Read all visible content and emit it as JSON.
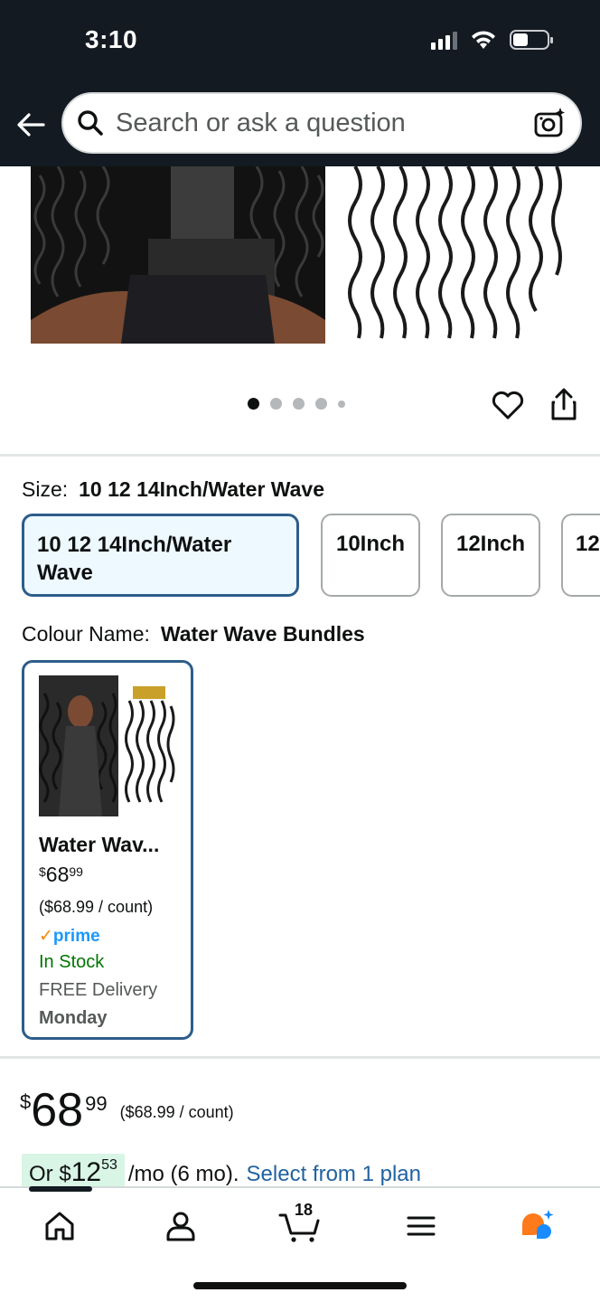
{
  "status_bar": {
    "time": "3:10"
  },
  "search": {
    "placeholder": "Search or ask a question"
  },
  "gallery": {
    "total_images": 5,
    "active_index": 0
  },
  "size": {
    "label": "Size:",
    "selected": "10 12 14Inch/Water Wave",
    "options": [
      {
        "label_line1": "10 12 14Inch/Water",
        "label_line2": "Wave"
      },
      {
        "label_line1": "10Inch"
      },
      {
        "label_line1": "12Inch"
      },
      {
        "label_line1": "12"
      }
    ]
  },
  "colour": {
    "label": "Colour Name:",
    "selected": "Water Wave Bundles",
    "card": {
      "name": "Water Wav...",
      "price_currency": "$",
      "price_main": "68",
      "price_cents": "99",
      "unit_price": "($68.99 / count)",
      "prime": "prime",
      "stock": "In Stock",
      "delivery": "FREE Delivery",
      "delivery_day": "Monday"
    }
  },
  "price": {
    "currency": "$",
    "main": "68",
    "cents": "99",
    "unit": "($68.99 / count)"
  },
  "installment": {
    "prefix": "Or $",
    "amount_main": "12",
    "amount_cents": "53",
    "term": "/mo (6 mo).",
    "link": "Select from 1 plan"
  },
  "tabbar": {
    "cart_count": "18",
    "tabs": [
      "home-icon",
      "account-icon",
      "cart-icon",
      "menu-icon",
      "rufus-icon"
    ]
  },
  "colors": {
    "header_bg": "#131a22",
    "selected_border": "#2d5d8a",
    "selected_bg": "#edf8ff",
    "link": "#2162a1",
    "in_stock": "#007600",
    "prime_blue": "#1a98ff",
    "installment_bg": "#d8f5e6"
  }
}
